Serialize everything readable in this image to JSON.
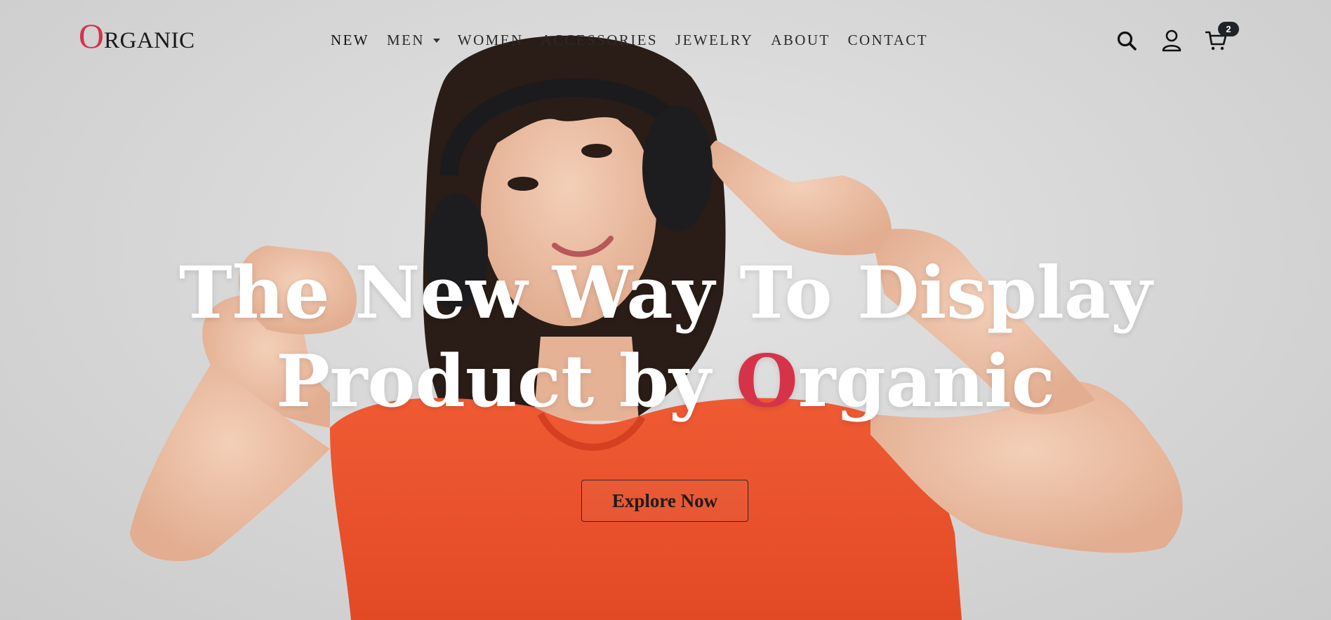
{
  "brand": {
    "first_letter": "O",
    "rest": "RGANIC",
    "accent_color": "#d6334a"
  },
  "nav": {
    "items": [
      {
        "label": "NEW"
      },
      {
        "label": "MEN",
        "has_dropdown": true
      },
      {
        "label": "WOMEN"
      },
      {
        "label": "ACCESSORIES"
      },
      {
        "label": "JEWELRY"
      },
      {
        "label": "ABOUT"
      },
      {
        "label": "CONTACT"
      }
    ]
  },
  "header_icons": {
    "search": "search-icon",
    "account": "user-icon",
    "cart": "cart-icon",
    "cart_count": "2"
  },
  "hero": {
    "headline_line1": "The New Way To Display",
    "headline_line2_prefix": "Product by ",
    "headline_brand_first": "O",
    "headline_brand_rest": "rganic",
    "cta_label": "Explore Now",
    "image": "woman-with-headphones-photo"
  }
}
